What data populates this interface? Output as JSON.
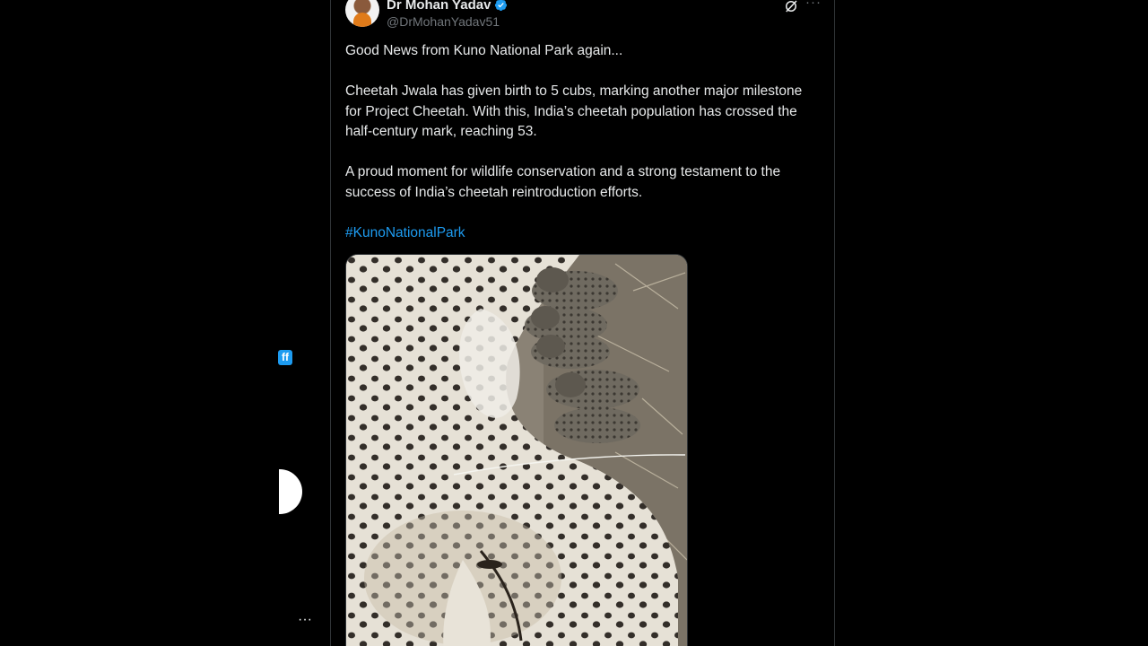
{
  "left_sidebar": {
    "badge_text": "ff",
    "more_label": "···"
  },
  "tweet": {
    "author": {
      "display_name": "Dr Mohan Yadav",
      "handle": "@DrMohanYadav51",
      "verified": true
    },
    "more_label": "···",
    "paragraphs": [
      "Good News from Kuno National Park again...",
      "Cheetah Jwala has given birth to 5 cubs, marking another major milestone for Project Cheetah. With this, India’s cheetah population has crossed the half-century mark, reaching 53.",
      "A proud moment for wildlife conservation and a strong testament to the success of India’s cheetah reintroduction efforts."
    ],
    "hashtag": "#KunoNationalPark"
  },
  "colors": {
    "background": "#000000",
    "text": "#e7e9ea",
    "secondary_text": "#71767b",
    "accent": "#1d9bf0",
    "border": "#2f3336"
  }
}
